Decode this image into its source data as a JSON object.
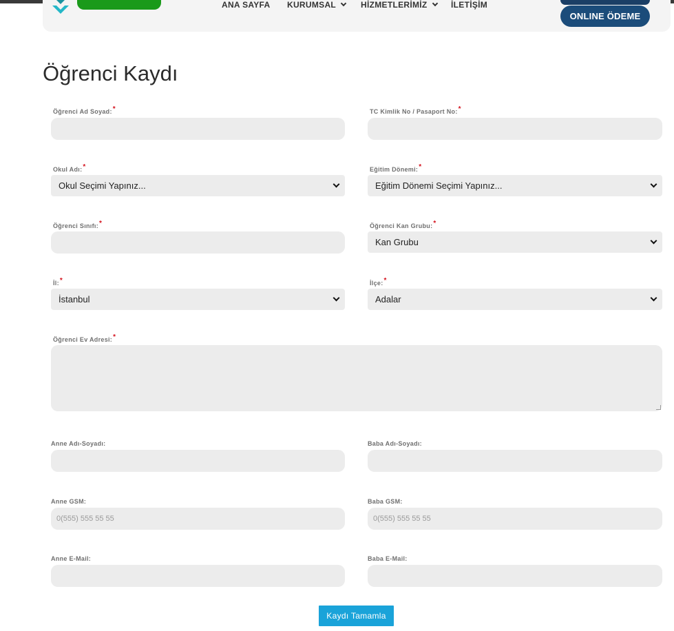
{
  "header": {
    "nav": [
      "ANA SAYFA",
      "KURUMSAL",
      "HİZMETLERİMİZ",
      "İLETİŞİM"
    ],
    "pay_label": "ONLINE ÖDEME"
  },
  "page_title": "Öğrenci Kaydı",
  "form": {
    "student_name_label": "Öğrenci Ad Soyad:",
    "tc_label": "TC Kimlik No / Pasaport No:",
    "school_label": "Okul Adı:",
    "school_value": "Okul Seçimi Yapınız...",
    "term_label": "Eğitim Dönemi:",
    "term_value": "Eğitim Dönemi Seçimi Yapınız...",
    "class_label": "Öğrenci Sınıfı:",
    "blood_label": "Öğrenci Kan Grubu:",
    "blood_value": "Kan Grubu",
    "city_label": "İl:",
    "city_value": "İstanbul",
    "district_label": "İlçe:",
    "district_value": "Adalar",
    "address_label": "Öğrenci Ev Adresi:",
    "mother_name_label": "Anne Adı-Soyadı:",
    "father_name_label": "Baba Adı-Soyadı:",
    "mother_gsm_label": "Anne GSM:",
    "father_gsm_label": "Baba GSM:",
    "gsm_placeholder": "0(555) 555 55 55",
    "mother_email_label": "Anne E-Mail:",
    "father_email_label": "Baba E-Mail:",
    "required_mark": "*",
    "submit_label": "Kaydı Tamamla"
  },
  "colors": {
    "accent": "#1aa3d9",
    "brand": "#1b4c7a",
    "required": "#d4131e",
    "logo_green": "#1a9a1a"
  }
}
